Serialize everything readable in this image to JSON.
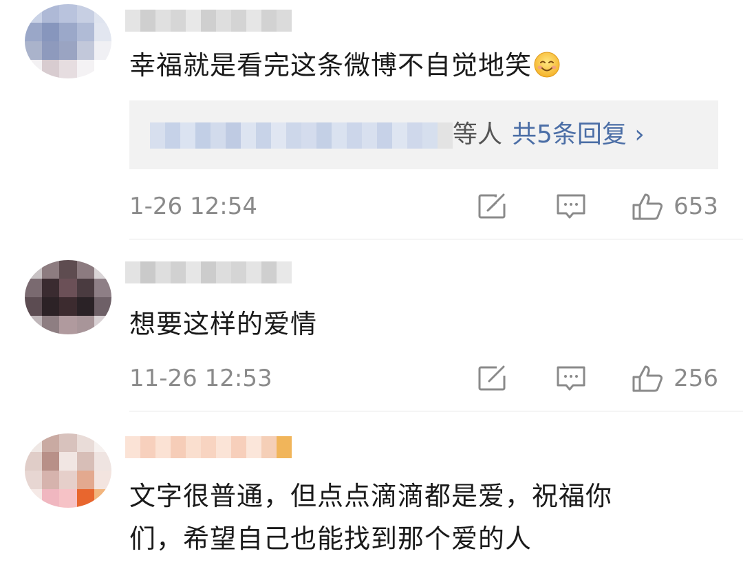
{
  "comments": [
    {
      "text": "幸福就是看完这条微博不自觉地笑",
      "emoji": "smiling-face-icon",
      "reply_tail": "等人",
      "reply_more": "共5条回复 ›",
      "time": "1-26 12:54",
      "likes": "653"
    },
    {
      "text": "想要这样的爱情",
      "time": "11-26 12:53",
      "likes": "256"
    },
    {
      "text_line1": "文字很普通，但点点滴滴都是爱，祝福你",
      "text_line2": "们，希望自己也能找到那个爱的人"
    }
  ],
  "icons": {
    "share": "share-icon",
    "comment": "comment-icon",
    "like": "thumbs-up-icon"
  },
  "colors": {
    "link_blue": "#4b6ea6",
    "meta_gray": "#8a8a8a",
    "reply_bg": "#f2f2f2"
  }
}
